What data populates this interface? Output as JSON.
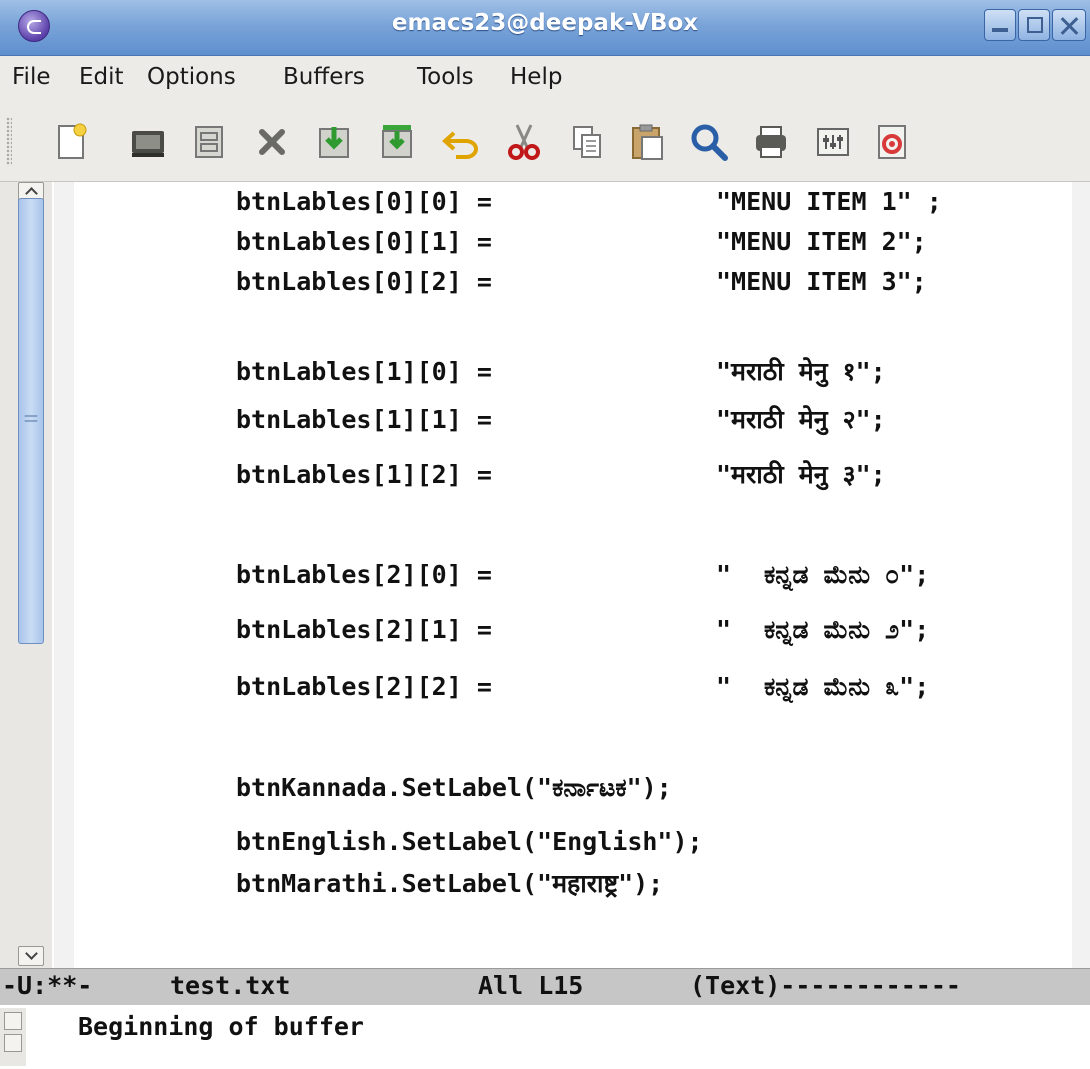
{
  "window": {
    "title": "emacs23@deepak-VBox"
  },
  "menu": [
    "File",
    "Edit",
    "Options",
    "Buffers",
    "Tools",
    "Help"
  ],
  "toolbar": {
    "icons": [
      "new-file-icon",
      "open-folder-icon",
      "dired-icon",
      "close-icon",
      "save-icon",
      "save-as-icon",
      "undo-icon",
      "cut-icon",
      "copy-icon",
      "paste-icon",
      "search-icon",
      "print-icon",
      "preferences-icon",
      "help-icon"
    ]
  },
  "buffer": {
    "lines": [
      {
        "code": "btnLables[0][0] =",
        "value": "\"MENU ITEM 1\" ;"
      },
      {
        "code": "btnLables[0][1] =",
        "value": "\"MENU ITEM 2\";"
      },
      {
        "code": "btnLables[0][2] =",
        "value": "\"MENU ITEM 3\";"
      },
      {
        "code": "btnLables[1][0] =",
        "value": "\"मराठी मेनु १\";"
      },
      {
        "code": "btnLables[1][1] =",
        "value": "\"मराठी मेनु २\";"
      },
      {
        "code": "btnLables[1][2] =",
        "value": "\"मराठी मेनु ३\";"
      },
      {
        "code": "btnLables[2][0] =",
        "quote": "\"",
        "value": "ಕನ್ನಡ ಮೆನು ೦\";"
      },
      {
        "code": "btnLables[2][1] =",
        "quote": "\"",
        "value": "ಕನ್ನಡ ಮೆನು ೨\";"
      },
      {
        "code": "btnLables[2][2] =",
        "quote": "\"",
        "value": "ಕನ್ನಡ ಮೆನು ೩\";"
      },
      {
        "code": "btnKannada.SetLabel(\"ಕರ್ನಾಟಕ\");"
      },
      {
        "code": "btnEnglish.SetLabel(\"English\");"
      },
      {
        "code": "btnMarathi.SetLabel(\"महाराष्ट्र\");"
      }
    ]
  },
  "modeline": {
    "status": "-U:**-",
    "filename": "test.txt",
    "position": "All L15",
    "mode": "(Text)------------"
  },
  "minibuffer": {
    "message": "Beginning of buffer"
  },
  "colors": {
    "titlebar": "#7aa4d8",
    "modeline": "#c6c6c6",
    "scroll_thumb": "#b8d0ef"
  }
}
